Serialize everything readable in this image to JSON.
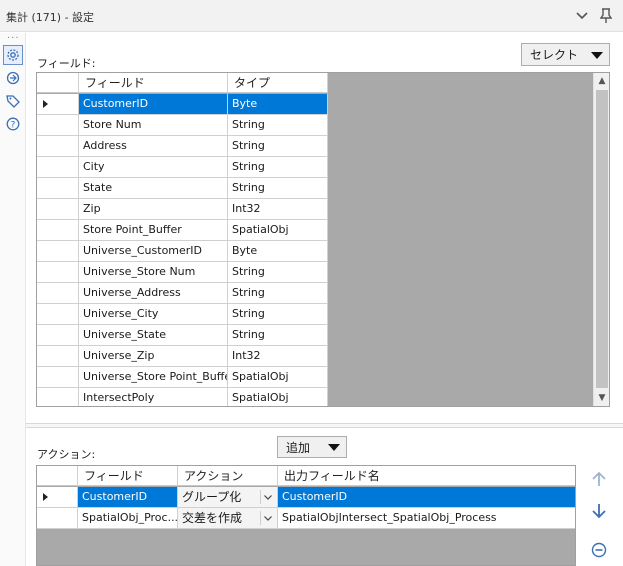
{
  "window": {
    "title": "集計 (171) - 設定"
  },
  "strip": {
    "dots": "···",
    "icons": [
      "gear-icon",
      "plugin-icon",
      "tag-icon",
      "help-icon"
    ]
  },
  "fields_section": {
    "label": "フィールド:",
    "select_mode": "セレクト",
    "columns": [
      "フィールド",
      "タイプ"
    ],
    "rows": [
      {
        "field": "CustomerID",
        "type": "Byte"
      },
      {
        "field": "Store Num",
        "type": "String"
      },
      {
        "field": "Address",
        "type": "String"
      },
      {
        "field": "City",
        "type": "String"
      },
      {
        "field": "State",
        "type": "String"
      },
      {
        "field": "Zip",
        "type": "Int32"
      },
      {
        "field": "Store Point_Buffer",
        "type": "SpatialObj"
      },
      {
        "field": "Universe_CustomerID",
        "type": "Byte"
      },
      {
        "field": "Universe_Store Num",
        "type": "String"
      },
      {
        "field": "Universe_Address",
        "type": "String"
      },
      {
        "field": "Universe_City",
        "type": "String"
      },
      {
        "field": "Universe_State",
        "type": "String"
      },
      {
        "field": "Universe_Zip",
        "type": "Int32"
      },
      {
        "field": "Universe_Store Point_Buffer",
        "type": "SpatialObj"
      },
      {
        "field": "IntersectPoly",
        "type": "SpatialObj"
      }
    ]
  },
  "actions_section": {
    "label": "アクション:",
    "add_button": "追加",
    "columns": [
      "フィールド",
      "アクション",
      "出力フィールド名"
    ],
    "rows": [
      {
        "field": "CustomerID",
        "action": "グループ化",
        "output": "CustomerID"
      },
      {
        "field": "SpatialObj_Proc...",
        "action": "交差を作成",
        "output": "SpatialObjIntersect_SpatialObj_Process"
      }
    ]
  },
  "colors": {
    "selection": "#0078d7",
    "grid_empty": "#a9a9a9",
    "accent_icon": "#3b6fb6"
  }
}
